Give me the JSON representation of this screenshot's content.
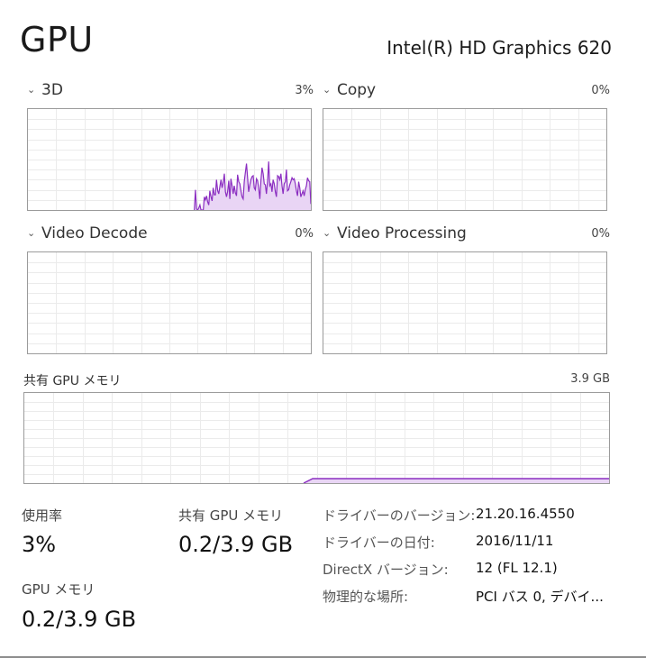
{
  "header": {
    "title": "GPU",
    "adapter_name": "Intel(R) HD Graphics 620"
  },
  "engines": [
    {
      "name": "3D",
      "percent": "3%",
      "usage_history": [
        0,
        0,
        0,
        0,
        0,
        0,
        0,
        0,
        0,
        0,
        0,
        0,
        0,
        0,
        0,
        0,
        0,
        0,
        0,
        0,
        0,
        0,
        0,
        0,
        0,
        0,
        0,
        0,
        0,
        0,
        0,
        0,
        0,
        0,
        0,
        0,
        0,
        0,
        0,
        0,
        0,
        0,
        0,
        0,
        0,
        0,
        0,
        0,
        0,
        0,
        0,
        0,
        0,
        0,
        0,
        0,
        0,
        0,
        0,
        0,
        0,
        0,
        0,
        0,
        0,
        0,
        0,
        0,
        0,
        0,
        0,
        0,
        0,
        0,
        0,
        0,
        0,
        0,
        0,
        0,
        0,
        0,
        0,
        0,
        0,
        0,
        0,
        0,
        0,
        0,
        0,
        0,
        0,
        0,
        0,
        0,
        0,
        0,
        0,
        0,
        0,
        0,
        0,
        0,
        0,
        0,
        0,
        0,
        0,
        0,
        0,
        0,
        0,
        0,
        0,
        0,
        0,
        0,
        0,
        0,
        0,
        0,
        0,
        0,
        0,
        0,
        0,
        0,
        0,
        0,
        0,
        0,
        0,
        0,
        0,
        0,
        0,
        0,
        0,
        0,
        0,
        0,
        0,
        0,
        0,
        0,
        0,
        0,
        0,
        0,
        0,
        20,
        1,
        0,
        2,
        5,
        0,
        0,
        0,
        13,
        10,
        14,
        8,
        5,
        19,
        13,
        9,
        22,
        15,
        15,
        30,
        19,
        16,
        23,
        30,
        22,
        27,
        36,
        18,
        13,
        18,
        29,
        11,
        31,
        24,
        16,
        24,
        17,
        14,
        35,
        28,
        26,
        19,
        13,
        11,
        28,
        37,
        46,
        32,
        18,
        25,
        30,
        33,
        34,
        22,
        20,
        31,
        29,
        22,
        11,
        29,
        42,
        36,
        26,
        25,
        16,
        29,
        48,
        24,
        26,
        18,
        30,
        26,
        18,
        13,
        34,
        33,
        30,
        36,
        24,
        16,
        26,
        28,
        40,
        19,
        20,
        25,
        28,
        32,
        30,
        31,
        26,
        19,
        14,
        28,
        22,
        13,
        16,
        19,
        14,
        20,
        24,
        32,
        29,
        28,
        6
      ]
    },
    {
      "name": "Copy",
      "percent": "0%",
      "usage_history": []
    },
    {
      "name": "Video Decode",
      "percent": "0%",
      "usage_history": []
    },
    {
      "name": "Video Processing",
      "percent": "0%",
      "usage_history": []
    }
  ],
  "shared_memory_graph": {
    "label": "共有 GPU メモリ",
    "max": "3.9 GB",
    "usage_fraction_history_note": "",
    "usage_fraction": 0.05
  },
  "stats": {
    "utilization_label": "使用率",
    "utilization_value": "3%",
    "shared_memory_label": "共有 GPU メモリ",
    "shared_memory_value": "0.2/3.9 GB",
    "gpu_memory_label": "GPU メモリ",
    "gpu_memory_value": "0.2/3.9 GB"
  },
  "details": [
    {
      "key": "ドライバーのバージョン:",
      "value": "21.20.16.4550"
    },
    {
      "key": "ドライバーの日付:",
      "value": "2016/11/11"
    },
    {
      "key": "DirectX バージョン:",
      "value": "12 (FL 12.1)"
    },
    {
      "key": "物理的な場所:",
      "value": "PCI バス 0, デバイ..."
    }
  ],
  "colors": {
    "graph_line": "#8b2ec1",
    "graph_fill": "#e9d5f5",
    "grid": "#ebebeb",
    "border": "#9b9b9b"
  },
  "icons": {
    "collapse": "chevron-down-icon"
  }
}
